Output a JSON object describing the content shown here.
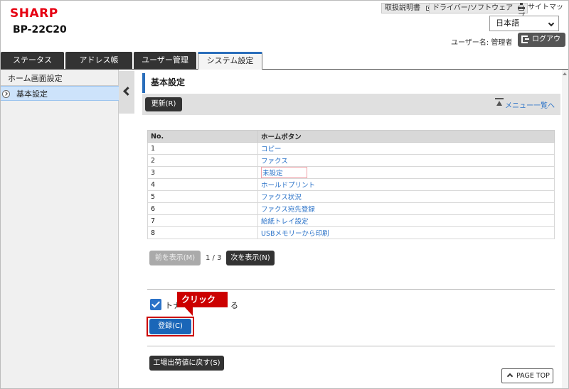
{
  "header": {
    "brand": "SHARP",
    "model": "BP-22C20",
    "links": [
      "取扱説明書",
      "ドライバー/ソフトウェア"
    ],
    "sitemap": "サイトマップ",
    "language": "日本語",
    "user_label": "ユーザー名: 管理者",
    "logout": "ログアウト"
  },
  "tabs": [
    {
      "label": "ステータス"
    },
    {
      "label": "アドレス帳"
    },
    {
      "label": "ユーザー管理"
    },
    {
      "label": "システム設定"
    }
  ],
  "sidebar": {
    "items": [
      {
        "label": "ホーム画面設定"
      },
      {
        "label": "基本設定"
      }
    ]
  },
  "main": {
    "title": "基本設定",
    "update_button": "更新(R)",
    "menu_list_link": "メニュー一覧へ",
    "table": {
      "headers": [
        "No.",
        "ホームボタン"
      ],
      "rows": [
        [
          "1",
          "コピー"
        ],
        [
          "2",
          "ファクス"
        ],
        [
          "3",
          "未設定"
        ],
        [
          "4",
          "ホールドプリント"
        ],
        [
          "5",
          "ファクス状況"
        ],
        [
          "6",
          "ファクス宛先登録"
        ],
        [
          "7",
          "給紙トレイ設定"
        ],
        [
          "8",
          "USBメモリーから印刷"
        ]
      ]
    },
    "prev_button": "前を表示(M)",
    "pager": "1 / 3",
    "next_button": "次を表示(N)",
    "checkbox_label": "トナ",
    "checkbox_label_tail": "る",
    "callout": "クリック",
    "register_button": "登録(C)",
    "factory_reset_button": "工場出荷値に戻す(S)",
    "page_top": "PAGE TOP"
  },
  "colors": {
    "brand": "#e60012",
    "accent": "#2a6ebb",
    "link": "#2a72c8",
    "callout": "#cc0000"
  }
}
